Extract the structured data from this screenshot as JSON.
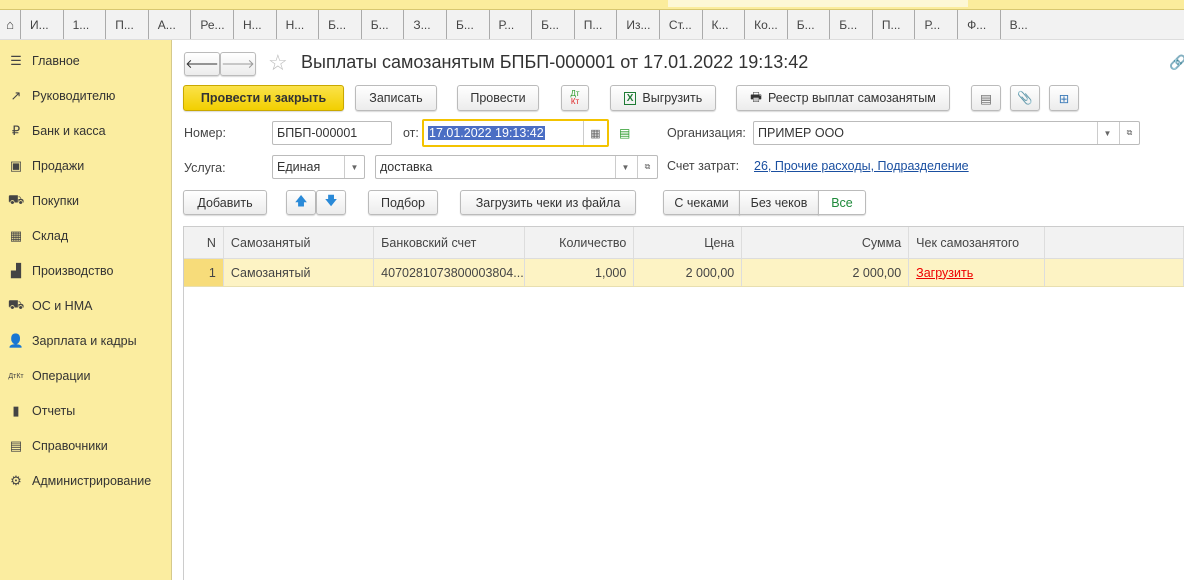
{
  "tabs": [
    "И...",
    "1...",
    "П...",
    "А...",
    "Ре...",
    "Н...",
    "Н...",
    "Б...",
    "Б...",
    "З...",
    "Б...",
    "Р...",
    "Б...",
    "П...",
    "Из...",
    "Ст...",
    "К...",
    "Ко...",
    "Б...",
    "Б...",
    "П...",
    "Р...",
    "Ф...",
    "В..."
  ],
  "sidebar": {
    "items": [
      {
        "icon": "menu-icon",
        "glyph": "☰",
        "label": "Главное"
      },
      {
        "icon": "trend-icon",
        "glyph": "↗",
        "label": "Руководителю"
      },
      {
        "icon": "ruble-icon",
        "glyph": "₽",
        "label": "Банк и касса"
      },
      {
        "icon": "bag-icon",
        "glyph": "▣",
        "label": "Продажи"
      },
      {
        "icon": "cart-icon",
        "glyph": "⛟",
        "label": "Покупки"
      },
      {
        "icon": "warehouse-icon",
        "glyph": "▦",
        "label": "Склад"
      },
      {
        "icon": "factory-icon",
        "glyph": "▟",
        "label": "Производство"
      },
      {
        "icon": "truck-icon",
        "glyph": "⛟",
        "label": "ОС и НМА"
      },
      {
        "icon": "person-icon",
        "glyph": "👤",
        "label": "Зарплата и кадры"
      },
      {
        "icon": "dt-kt-icon",
        "glyph": "ДтКт",
        "label": "Операции"
      },
      {
        "icon": "bar-chart-icon",
        "glyph": "▮",
        "label": "Отчеты"
      },
      {
        "icon": "books-icon",
        "glyph": "▤",
        "label": "Справочники"
      },
      {
        "icon": "gear-icon",
        "glyph": "⚙",
        "label": "Администрирование"
      }
    ]
  },
  "document": {
    "title": "Выплаты самозанятым БПБП-000001 от 17.01.2022 19:13:42",
    "toolbar": {
      "post_close": "Провести и закрыть",
      "save": "Записать",
      "post": "Провести",
      "dtkt": "Дт Кт",
      "export": "Выгрузить",
      "registry": "Реестр выплат самозанятым"
    },
    "number_label": "Номер:",
    "number": "БПБП-000001",
    "date_label": "от:",
    "date": "17.01.2022 19:13:42",
    "org_label": "Организация:",
    "org": "ПРИМЕР ООО",
    "service_label": "Услуга:",
    "service_type": "Единая",
    "service": "доставка",
    "cost_label": "Счет затрат:",
    "cost": "26, Прочие расходы, Подразделение",
    "table_toolbar": {
      "add": "Добавить",
      "pick": "Подбор",
      "load": "Загрузить чеки из файла",
      "filters": [
        "С чеками",
        "Без чеков",
        "Все"
      ]
    }
  },
  "table": {
    "columns": [
      "N",
      "Самозанятый",
      "Банковский счет",
      "Количество",
      "Цена",
      "Сумма",
      "Чек самозанятого"
    ],
    "rows": [
      [
        "1",
        "Самозанятый",
        "4070281073800003804...",
        "1,000",
        "2 000,00",
        "2 000,00",
        "Загрузить"
      ]
    ]
  }
}
